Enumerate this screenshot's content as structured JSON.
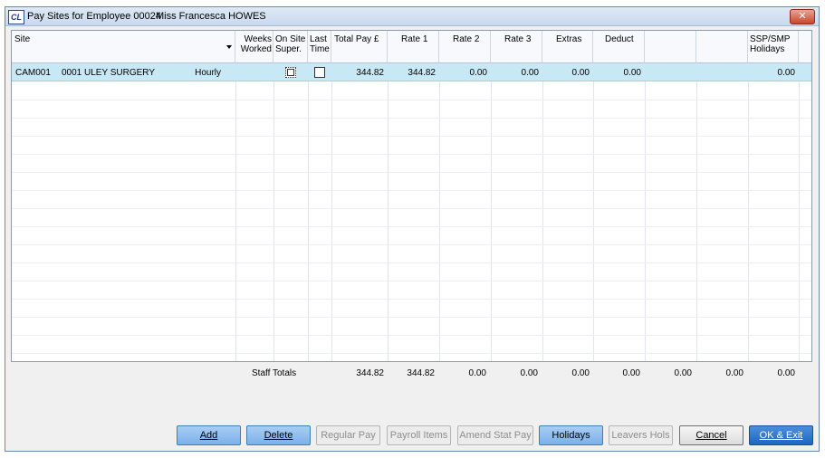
{
  "window": {
    "title": "Pay Sites for Employee 00024",
    "employee_name": "Miss Francesca HOWES",
    "app_icon_text": "CL",
    "close_glyph": "✕"
  },
  "grid": {
    "headers": {
      "site": "Site",
      "weeks_1": "Weeks",
      "weeks_2": "Worked",
      "onsite_1": "On Site",
      "onsite_2": "Super.",
      "last_1": "Last",
      "last_2": "Time",
      "total_pay": "Total Pay £",
      "rate1": "Rate 1",
      "rate2": "Rate 2",
      "rate3": "Rate 3",
      "extras": "Extras",
      "deduct": "Deduct",
      "blank1": "",
      "blank2": "",
      "ssp_1": "SSP/SMP",
      "ssp_2": "Holidays"
    },
    "rows": [
      {
        "site_code": "CAM001",
        "site_name": "0001 ULEY SURGERY",
        "pay_type": "Hourly",
        "weeks_worked": "",
        "on_site_super": false,
        "last_time": false,
        "total_pay": "344.82",
        "rate1": "344.82",
        "rate2": "0.00",
        "rate3": "0.00",
        "extras": "0.00",
        "deduct": "0.00",
        "ssp_holidays": "0.00"
      }
    ]
  },
  "totals": {
    "label": "Staff Totals",
    "total_pay": "344.82",
    "rate1": "344.82",
    "rate2": "0.00",
    "rate3": "0.00",
    "extras": "0.00",
    "deduct": "0.00",
    "blank1": "0.00",
    "blank2": "0.00",
    "ssp_holidays": "0.00"
  },
  "buttons": {
    "add": "Add",
    "delete": "Delete",
    "regular_pay": "Regular Pay",
    "payroll_items": "Payroll Items",
    "amend_stat_pay": "Amend Stat Pay",
    "holidays": "Holidays",
    "leavers_hols": "Leavers Hols",
    "cancel": "Cancel",
    "ok_exit": "OK & Exit"
  },
  "colors": {
    "selected_row": "#c9e8f5",
    "primary_button": "#1f65c0",
    "blue_button": "#7ab1ea"
  }
}
